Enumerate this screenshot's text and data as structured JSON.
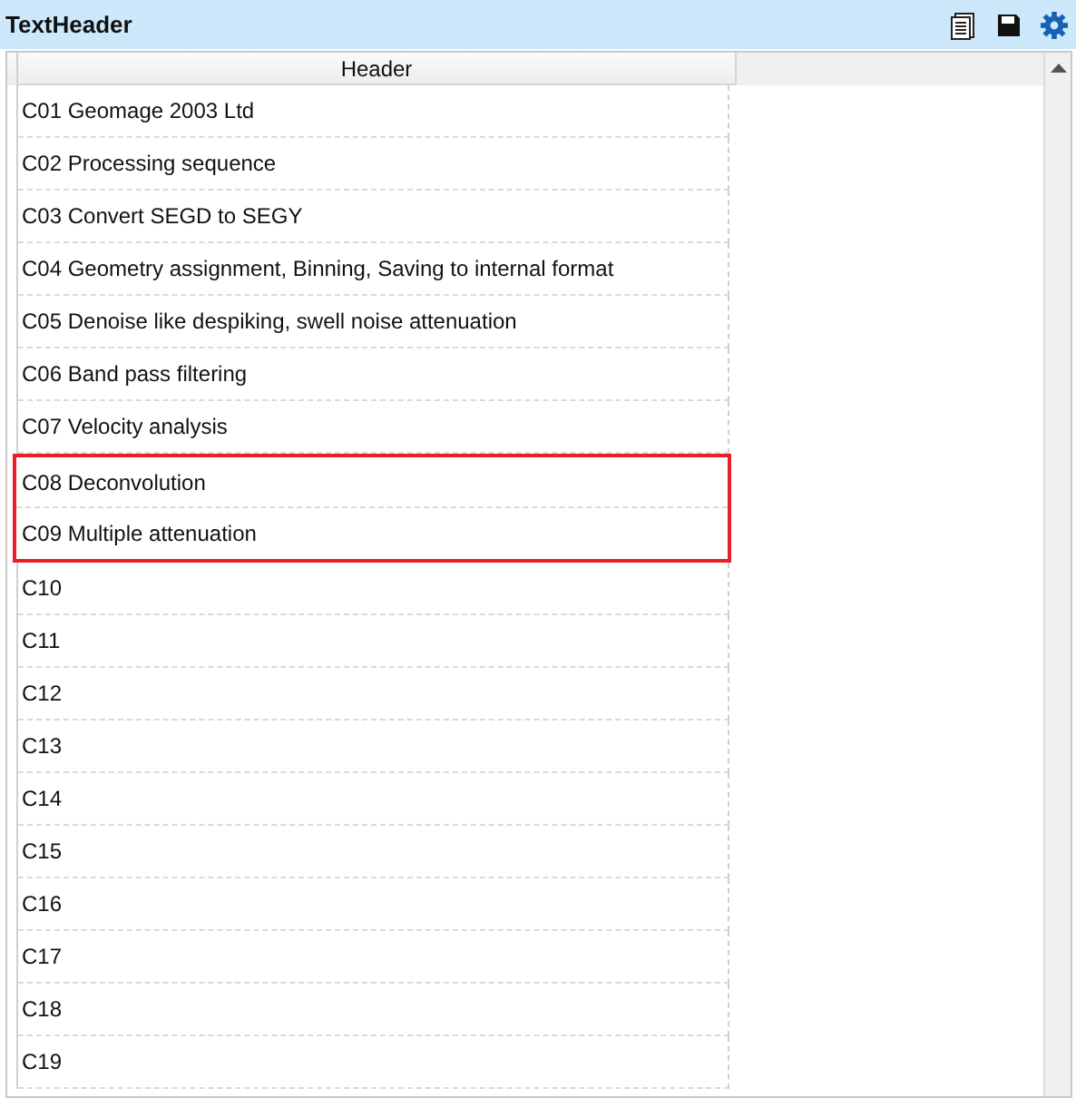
{
  "panel": {
    "title": "TextHeader"
  },
  "table": {
    "columns": [
      "Header"
    ],
    "rows": [
      {
        "text": "C01 Geomage 2003 Ltd",
        "highlighted": false
      },
      {
        "text": "C02 Processing sequence",
        "highlighted": false
      },
      {
        "text": "C03 Convert SEGD to SEGY",
        "highlighted": false
      },
      {
        "text": "C04 Geometry assignment, Binning, Saving to internal format",
        "highlighted": false
      },
      {
        "text": "C05 Denoise like despiking, swell noise attenuation",
        "highlighted": false
      },
      {
        "text": "C06 Band pass filtering",
        "highlighted": false
      },
      {
        "text": "C07 Velocity analysis",
        "highlighted": false
      },
      {
        "text": "C08 Deconvolution",
        "highlighted": true
      },
      {
        "text": "C09 Multiple attenuation",
        "highlighted": true
      },
      {
        "text": "C10",
        "highlighted": false
      },
      {
        "text": "C11",
        "highlighted": false
      },
      {
        "text": "C12",
        "highlighted": false
      },
      {
        "text": "C13",
        "highlighted": false
      },
      {
        "text": "C14",
        "highlighted": false
      },
      {
        "text": "C15",
        "highlighted": false
      },
      {
        "text": "C16",
        "highlighted": false
      },
      {
        "text": "C17",
        "highlighted": false
      },
      {
        "text": "C18",
        "highlighted": false
      },
      {
        "text": "C19",
        "highlighted": false
      }
    ]
  }
}
